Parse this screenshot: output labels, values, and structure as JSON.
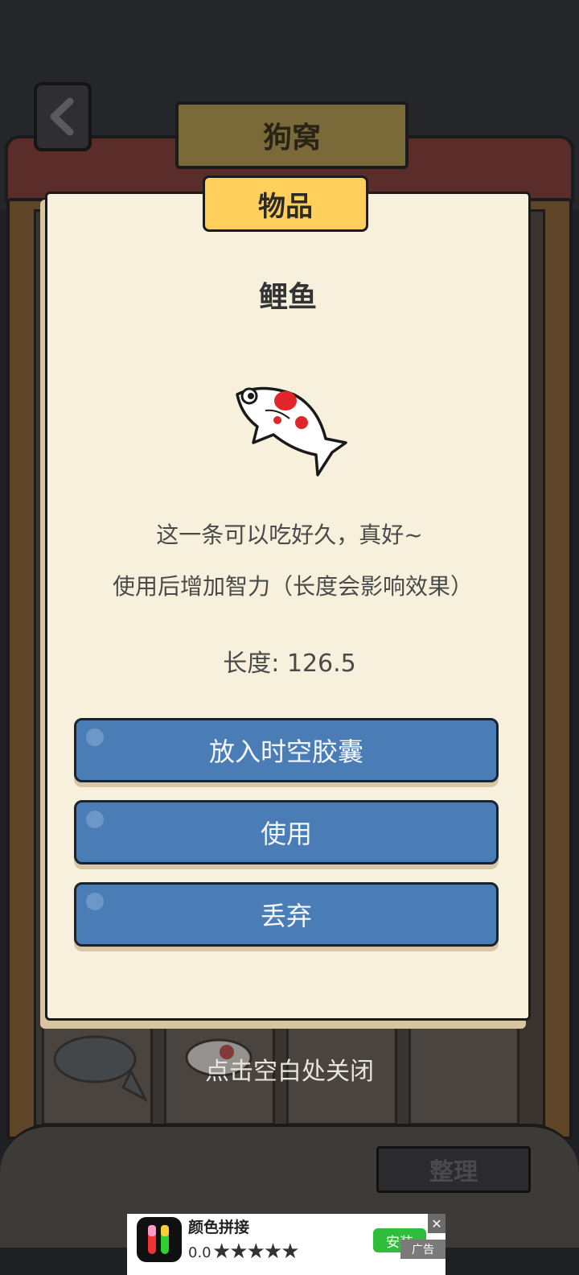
{
  "header": {
    "title": "狗窝",
    "back_icon": "chevron-left-icon"
  },
  "modal": {
    "tab": "物品",
    "item_name": "鲤鱼",
    "flavor_text": "这一条可以吃好久，真好~",
    "effect_text": "使用后增加智力（长度会影响效果）",
    "length_text": "长度: 126.5",
    "buttons": {
      "capsule": "放入时空胶囊",
      "use": "使用",
      "discard": "丢弃"
    },
    "close_hint": "点击空白处关闭"
  },
  "footer": {
    "sort_label": "整理"
  },
  "ad": {
    "title": "颜色拼接",
    "rating": "0.0",
    "stars": "★★★★★",
    "install_label": "安装",
    "tag": "广告",
    "close_icon": "close-icon"
  },
  "colors": {
    "button_blue": "#4a7db6",
    "paper": "#f7f0dc",
    "tab_yellow": "#ffcf5c",
    "koi_red": "#e0262b"
  }
}
